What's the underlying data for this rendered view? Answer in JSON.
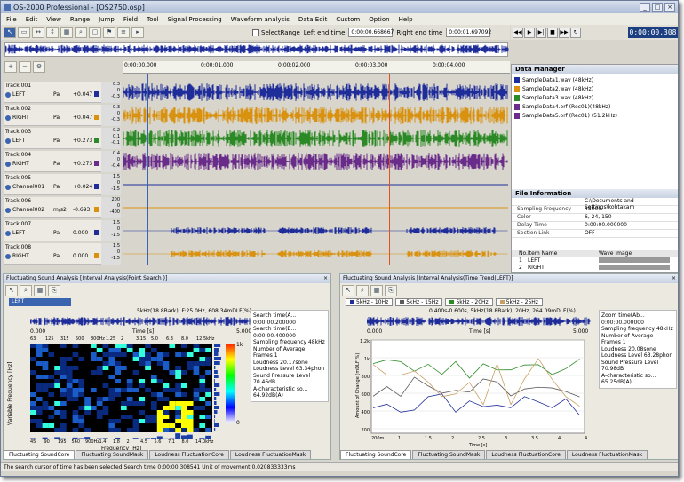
{
  "window": {
    "title": "OS-2000 Professional - [OS2750.osp]",
    "controls": [
      "_",
      "□",
      "×"
    ]
  },
  "menu": [
    "File",
    "Edit",
    "View",
    "Range",
    "Jump",
    "Field",
    "Tool",
    "Signal Processing",
    "Waveform analysis",
    "Data Edit",
    "Custom",
    "Option",
    "Help"
  ],
  "toolbar": {
    "select_range": "SelectRange",
    "left_end_label": "Left end time",
    "left_end_value": "0:00:00.668667",
    "right_end_label": "Right end time",
    "right_end_value": "0:00:01.697092"
  },
  "transport": {
    "time": "0:00:00.308"
  },
  "ruler": [
    "0:00:00.000",
    "0:00:01.000",
    "0:00:02.000",
    "0:00:03.000",
    "0:00:04.000"
  ],
  "tracks": [
    {
      "name": "Track 001",
      "channel": "LEFT",
      "unit": "Pa",
      "value": "+0.047",
      "color": "#1f2d9a",
      "scale": [
        "0.3",
        "0",
        "-0.3"
      ]
    },
    {
      "name": "Track 002",
      "channel": "RIGHT",
      "unit": "Pa",
      "value": "+0.047",
      "color": "#d9920f",
      "scale": [
        "0.3",
        "0",
        "-0.3"
      ]
    },
    {
      "name": "Track 003",
      "channel": "LEFT",
      "unit": "Pa",
      "value": "+0.273",
      "color": "#2b8a26",
      "scale": [
        "0.2",
        "0.1",
        "-0.1"
      ]
    },
    {
      "name": "Track 004",
      "channel": "RIGHT",
      "unit": "Pa",
      "value": "+0.273",
      "color": "#6a2c8a",
      "scale": [
        "0.4",
        "0",
        "-0.4"
      ]
    },
    {
      "name": "Track 005",
      "channel": "Channel001",
      "unit": "Pa",
      "value": "+0.024",
      "color": "#1f2d9a",
      "scale": [
        "1.5",
        "0",
        "-1.5"
      ]
    },
    {
      "name": "Track 006",
      "channel": "Channel002",
      "unit": "m/s2",
      "value": "-0.693",
      "color": "#d9920f",
      "scale": [
        "200",
        "0",
        "-400"
      ]
    },
    {
      "name": "Track 007",
      "channel": "LEFT",
      "unit": "Pa",
      "value": "0.000",
      "color": "#1f2d9a",
      "scale": [
        "1.5",
        "0",
        "-1.5"
      ]
    },
    {
      "name": "Track 008",
      "channel": "RIGHT",
      "unit": "Pa",
      "value": "0.000",
      "color": "#d9920f",
      "scale": [
        "1.5",
        "0",
        "-1.5"
      ]
    }
  ],
  "data_manager": {
    "title": "Data Manager",
    "files": [
      {
        "name": "SampleData1.wav (48kHz)",
        "color": "#1f2d9a"
      },
      {
        "name": "SampleData2.wav (48kHz)",
        "color": "#d9920f"
      },
      {
        "name": "SampleData3.wav (48kHz)",
        "color": "#2b8a26"
      },
      {
        "name": "SampleData4.orf (Rec01)(48kHz)",
        "color": "#6a2c8a"
      },
      {
        "name": "SampleData5.orf (Rec01) (51.2kHz)",
        "color": "#6a2c8a"
      }
    ]
  },
  "file_info": {
    "title": "File Information",
    "rows": [
      {
        "k": "",
        "v": "C:\\Documents and Settings\\kohtakam"
      },
      {
        "k": "Sampling Frequency",
        "v": "48000"
      },
      {
        "k": "Color",
        "v": "6, 24, 150"
      },
      {
        "k": "Delay Time",
        "v": "0:00:00.000000"
      },
      {
        "k": "Section Link",
        "v": "OFF"
      }
    ]
  },
  "item_list": {
    "headers": [
      "No.",
      "Item Name",
      "Wave Image"
    ],
    "rows": [
      {
        "no": "1",
        "name": "LEFT"
      },
      {
        "no": "2",
        "name": "RIGHT"
      }
    ]
  },
  "left_panel": {
    "title": "Fluctuating Sound Analysis [Interval Analysis(Point Search )]",
    "channel": "LEFT",
    "freq_info": "5kHz(18.8Bark), F:25.0Hz, 608.34mDLF(%)",
    "time_axis": [
      "0.000",
      "Time [s]",
      "5.000"
    ],
    "top_freqs": [
      "63",
      "125",
      "315",
      "500",
      "800Hz",
      "1.25",
      "2",
      "3.15",
      "5.0",
      "6.3",
      "8.0",
      "12.5kHz"
    ],
    "bottom_freqs": [
      "45",
      "90",
      "195",
      "560",
      "900Hz",
      "1.4",
      "1.8",
      "2",
      "4.5",
      "5.6",
      "7.1",
      "8.0",
      "14.0kHz"
    ],
    "y_label": "Variable Frequency [Hz]",
    "x_label": "Frequency [Hz]",
    "colorbar": [
      "1k",
      "0"
    ],
    "info": [
      "Search time(A... 0:00:00.200000",
      "Search time(B... 0:00:00.400000",
      "Sampling frequency   48kHz",
      "Number of Average Frames  1",
      "Loudness   20.17sone",
      "Loudness Level   63.34phon",
      "Sound Pressure Level  70.46dB",
      "A-characteristic so...  64.92dB(A)"
    ],
    "tabs": [
      "Fluctuating SoundCore",
      "Fluctuating SoundMask",
      "Loudness FluctuationCore",
      "Loudness FluctuationMask"
    ]
  },
  "right_panel": {
    "title": "Fluctuating Sound Analysis [Interval Analysis(Time Trend(LEFT)]",
    "legend": [
      "5kHz - 10Hz",
      "5kHz - 15Hz",
      "5kHz - 20Hz",
      "5kHz - 25Hz"
    ],
    "freq_info": "0.400s-0.600s, 5kHz(18.8Bark), 20Hz, 264.09mDLF(%)",
    "time_axis": [
      "0.000",
      "Time [s]",
      "5.000"
    ],
    "y_label": "Amount of Change [mDLF(%)]",
    "yticks": [
      "1.2k",
      "1k",
      "800",
      "600",
      "400",
      "200"
    ],
    "xticks": [
      "200m",
      "1",
      "1.5",
      "2",
      "2.5",
      "3",
      "3.5",
      "4",
      "4.8"
    ],
    "x_label": "Time [s]",
    "info": [
      "Zoom time(Ab... 0:00:00.000000",
      "Sampling frequency  48kHz",
      "Number of Average Frames  1",
      "Loudness   20.08sone",
      "Loudness Level   63.28phon",
      "Sound Pressure Level  70.98dB",
      "A-characteristic so...  65.25dB(A)"
    ],
    "tabs": [
      "Fluctuating SoundCore",
      "Fluctuating SoundMask",
      "Loudness FluctuationCore",
      "Loudness FluctuationMask"
    ]
  },
  "status": "The search cursor of time has been selected  Search time 0:00:00.308541  Unit of movement 0.020833333ms"
}
